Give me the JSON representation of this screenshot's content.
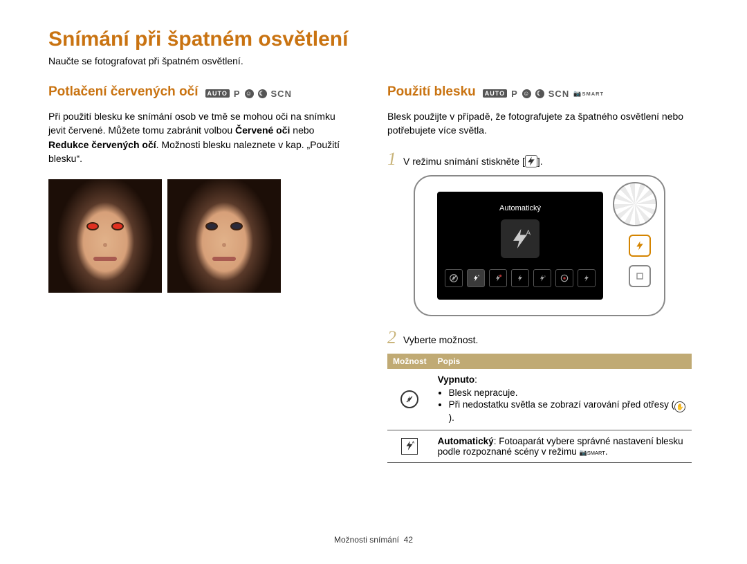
{
  "page": {
    "title": "Snímání při špatném osvětlení",
    "lead": "Naučte se fotografovat při špatném osvětlení.",
    "footer_section": "Možnosti snímání",
    "footer_page": "42"
  },
  "modes": {
    "auto": "AUTO",
    "p": "P",
    "scn": "SCN",
    "smart": "SMART"
  },
  "left": {
    "heading": "Potlačení červených očí",
    "mode_badges": [
      "auto",
      "p",
      "portrait",
      "night",
      "scn"
    ],
    "body_parts": [
      "Při použití blesku ke snímání osob ve tmě se mohou oči na snímku jevit červené. Můžete tomu zabránit volbou ",
      "Červené oči",
      " nebo ",
      "Redukce červených očí",
      ". Možnosti blesku naleznete v kap. „Použití blesku“."
    ]
  },
  "right": {
    "heading": "Použití blesku",
    "mode_badges": [
      "auto",
      "p",
      "portrait",
      "night",
      "scn",
      "smart"
    ],
    "body": "Blesk použijte v případě, že fotografujete za špatného osvětlení nebo potřebujete více světla.",
    "step1": "V režimu snímání stiskněte [",
    "step1_end": "].",
    "step2": "Vyberte možnost.",
    "camera_lcd_label": "Automatický",
    "table": {
      "head_option": "Možnost",
      "head_desc": "Popis",
      "rows": [
        {
          "icon": "flash-off",
          "title": "Vypnuto",
          "bullets": [
            "Blesk nepracuje.",
            "Při nedostatku světla se zobrazí varování před otřesy (HAND_ICON)."
          ]
        },
        {
          "icon": "flash-smart-auto",
          "title": "Automatický",
          "desc": ": Fotoaparát vybere správné nastavení blesku podle rozpoznané scény v režimu SMART_ICON."
        }
      ]
    }
  }
}
